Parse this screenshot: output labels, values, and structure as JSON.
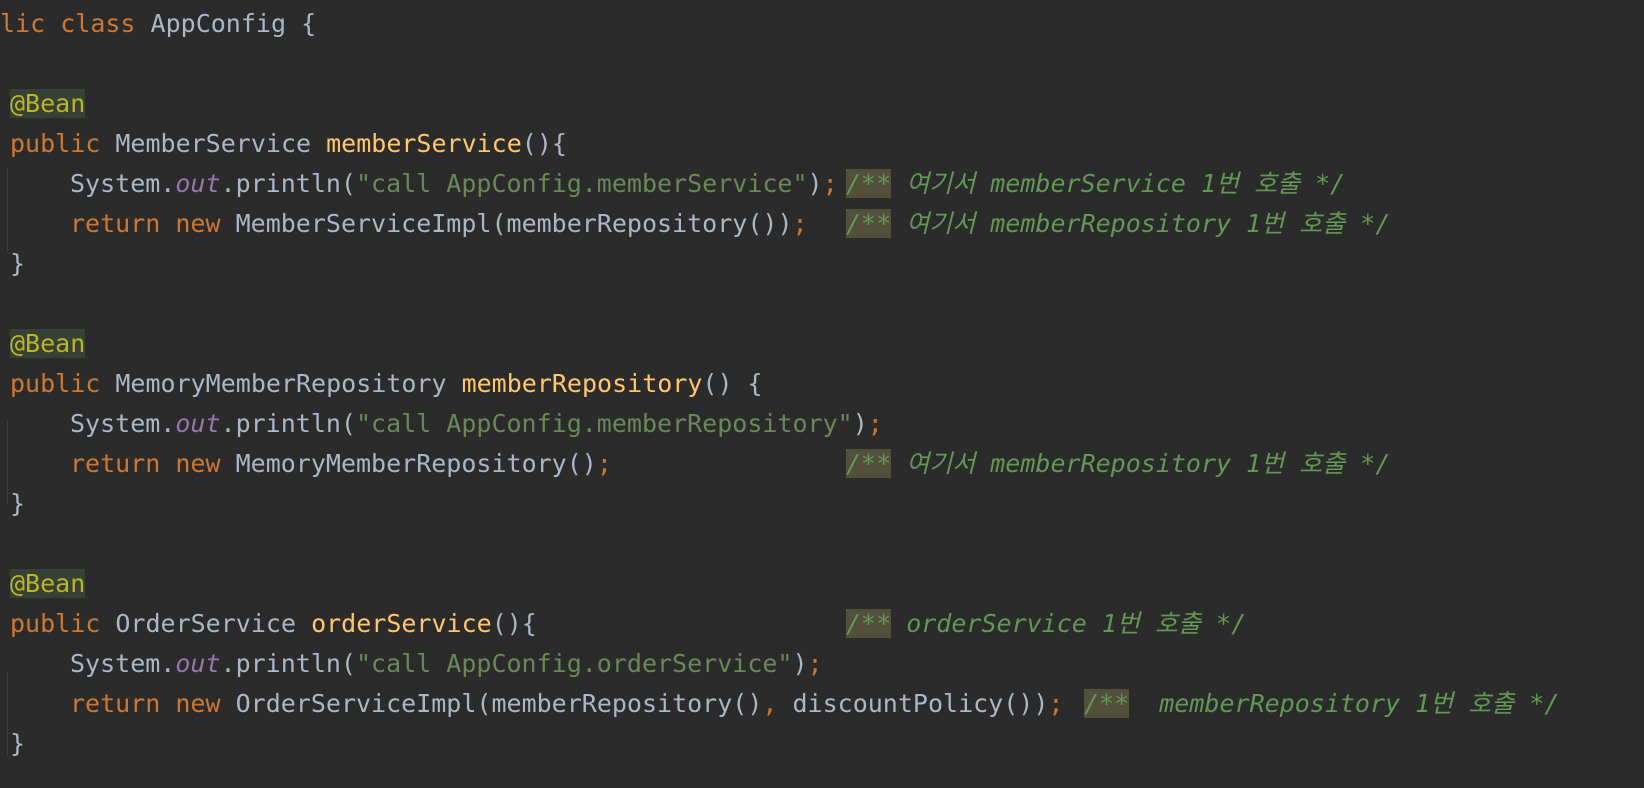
{
  "code": {
    "header": {
      "kw1": "lic",
      "kw2": "class",
      "name": "AppConfig",
      "brace": "{"
    },
    "bean1": {
      "annotation": "@Bean",
      "sig": {
        "kw": "public",
        "type": "MemberService",
        "name": "memberService",
        "rest": "(){"
      },
      "line1": {
        "prefix": "System.",
        "out": "out",
        "call": ".println(",
        "str": "\"call AppConfig.memberService\"",
        "close": ")",
        "semi": ";",
        "cstart": "/**",
        "ctext": " 여기서 memberService 1번 호출 */"
      },
      "line2": {
        "ret": "return",
        "new": "new",
        "expr": "MemberServiceImpl(memberRepository())",
        "semi": ";",
        "cstart": "/**",
        "ctext": " 여기서 memberRepository 1번 호출 */"
      },
      "close": "}"
    },
    "bean2": {
      "annotation": "@Bean",
      "sig": {
        "kw": "public",
        "type": "MemoryMemberRepository",
        "name": "memberRepository",
        "rest": "() {"
      },
      "line1": {
        "prefix": "System.",
        "out": "out",
        "call": ".println(",
        "str": "\"call AppConfig.memberRepository\"",
        "close": ")",
        "semi": ";"
      },
      "line2": {
        "ret": "return",
        "new": "new",
        "expr": "MemoryMemberRepository()",
        "semi": ";",
        "cstart": "/**",
        "ctext": " 여기서 memberRepository 1번 호출 */"
      },
      "close": "}"
    },
    "bean3": {
      "annotation": "@Bean",
      "sig": {
        "kw": "public",
        "type": "OrderService",
        "name": "orderService",
        "rest": "(){",
        "cstart": "/**",
        "ctext": " orderService 1번 호출 */"
      },
      "line1": {
        "prefix": "System.",
        "out": "out",
        "call": ".println(",
        "str": "\"call AppConfig.orderService\"",
        "close": ")",
        "semi": ";"
      },
      "line2": {
        "ret": "return",
        "new": "new",
        "expr1": "OrderServiceImpl(memberRepository()",
        "comma": ",",
        "expr2": " discountPolicy())",
        "semi": ";",
        "cstart": "/**",
        "ctext": "  memberRepository 1번 호출 */"
      },
      "close": "}"
    }
  }
}
